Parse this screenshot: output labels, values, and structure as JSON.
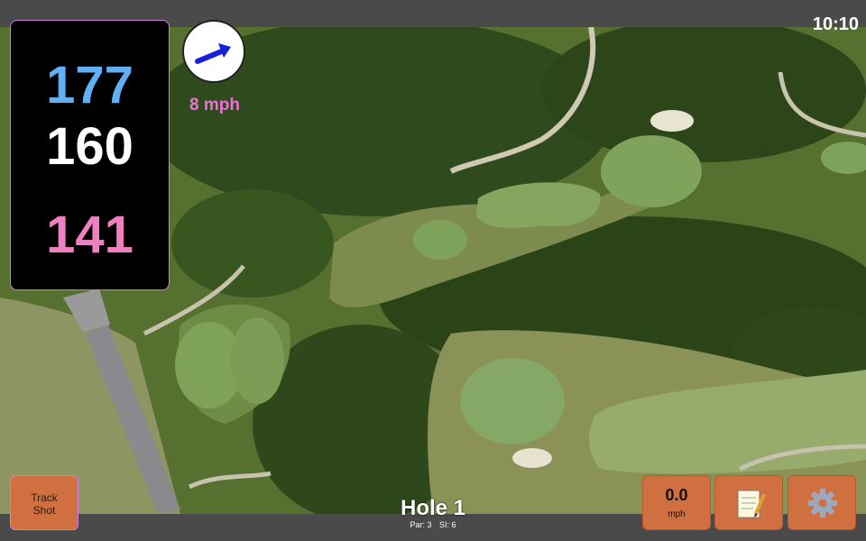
{
  "status": {
    "time": "10:10"
  },
  "distances": {
    "back": "177",
    "middle": "160",
    "front": "141"
  },
  "wind": {
    "speed": "8 mph",
    "icon": "arrow-right-icon",
    "color": "#ee70d8"
  },
  "buttons": {
    "track_shot": "Track\nShot",
    "speed_value": "0.0",
    "speed_unit": "mph",
    "notes_icon": "notepad-icon",
    "settings_icon": "gear-icon"
  },
  "hole": {
    "title": "Hole 1",
    "par": "Par: 3",
    "si": "SI: 6"
  },
  "colors": {
    "back": "#5fb0f5",
    "middle": "#ffffff",
    "front": "#ee80c0",
    "button": "#d07040",
    "accent_border": "#d17ce0"
  }
}
